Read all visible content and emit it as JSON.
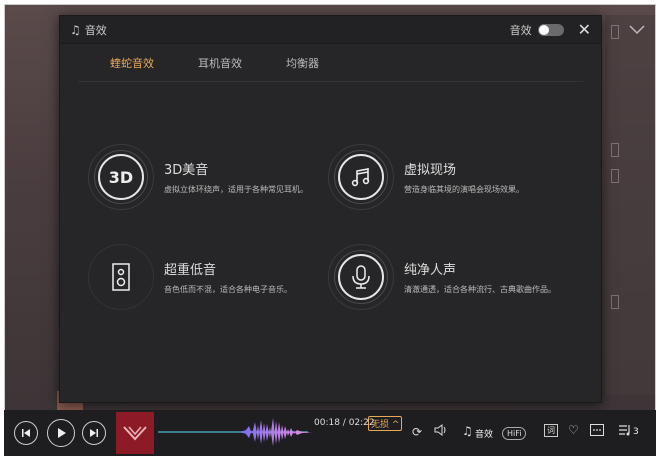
{
  "dialog": {
    "title": "音效",
    "toggle_label": "音效",
    "toggle_on": false,
    "close_icon": "close-icon"
  },
  "tabs": [
    {
      "label": "蝰蛇音效",
      "active": true
    },
    {
      "label": "耳机音效",
      "active": false
    },
    {
      "label": "均衡器",
      "active": false
    }
  ],
  "effects": [
    {
      "icon_text": "3D",
      "icon": "3d-icon",
      "name": "3D美音",
      "desc": "虚拟立体环绕声，适用于各种常见耳机。"
    },
    {
      "icon": "music-note-icon",
      "name": "虚拟现场",
      "desc": "营造身临其境的演唱会现场效果。"
    },
    {
      "icon": "speaker-icon",
      "name": "超重低音",
      "desc": "音色低而不混，适合各种电子音乐。"
    },
    {
      "icon": "microphone-icon",
      "name": "纯净人声",
      "desc": "清澈通透，适合各种流行、古典歌曲作品。"
    }
  ],
  "player": {
    "time": "00:18 / 02:22",
    "quality": "无损 ^",
    "effect_label": "音效",
    "hifi_label": "HiFi",
    "lyrics_label": "词",
    "playlist_count": "3",
    "accent": "#e8a95a",
    "waveform_colors": [
      "#7b6cf0",
      "#b57fe6",
      "#e98fe0"
    ]
  }
}
